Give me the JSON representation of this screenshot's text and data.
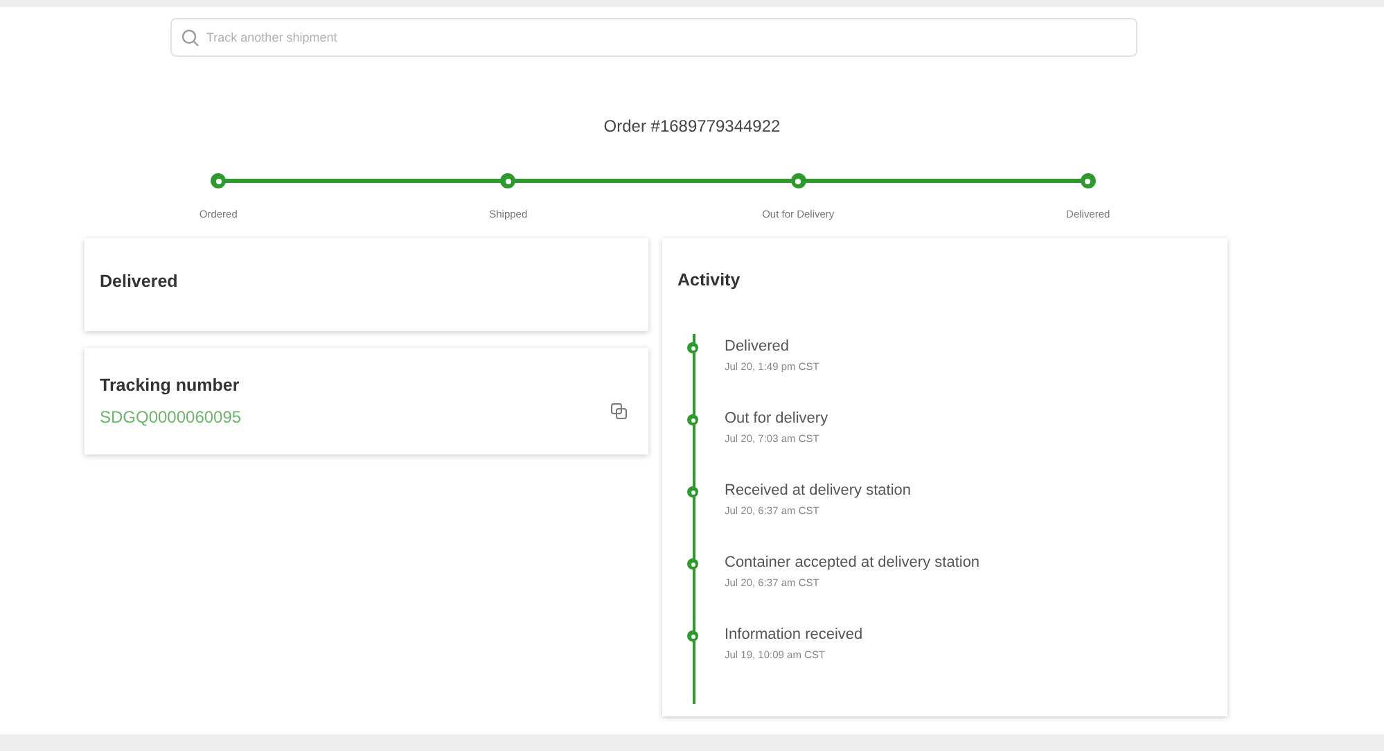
{
  "search": {
    "placeholder": "Track another shipment"
  },
  "order_title": "Order #1689779344922",
  "progress_steps": [
    {
      "label": "Ordered",
      "completed": true
    },
    {
      "label": "Shipped",
      "completed": true
    },
    {
      "label": "Out for Delivery",
      "completed": true
    },
    {
      "label": "Delivered",
      "completed": true
    }
  ],
  "status_card": {
    "title": "Delivered"
  },
  "tracking_card": {
    "title": "Tracking number",
    "number": "SDGQ0000060095"
  },
  "activity": {
    "title": "Activity",
    "events": [
      {
        "title": "Delivered",
        "time": "Jul 20, 1:49 pm CST"
      },
      {
        "title": "Out for delivery",
        "time": "Jul 20, 7:03 am CST"
      },
      {
        "title": "Received at delivery station",
        "time": "Jul 20, 6:37 am CST"
      },
      {
        "title": "Container accepted at delivery station",
        "time": "Jul 20, 6:37 am CST"
      },
      {
        "title": "Information received",
        "time": "Jul 19, 10:09 am CST"
      }
    ]
  }
}
